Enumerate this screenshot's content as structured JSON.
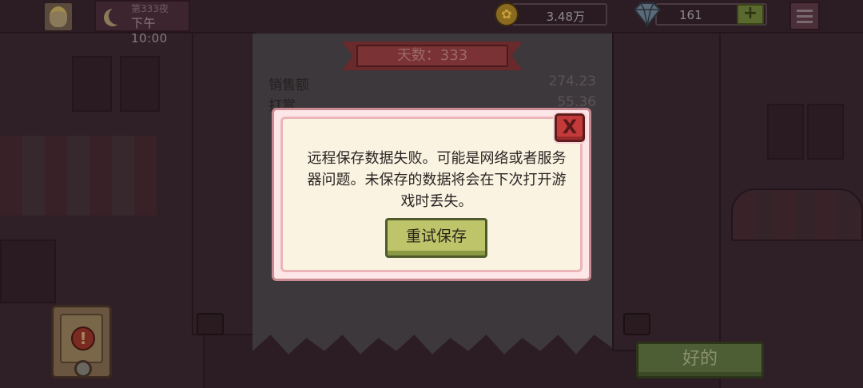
{
  "hud": {
    "day_label": "第333夜",
    "time_label": "下午10:00",
    "coins": "3.48万",
    "gems": "161",
    "plus": "+"
  },
  "receipt": {
    "title": "天数：333",
    "rows": [
      {
        "label": "销售额",
        "value": "274.23"
      },
      {
        "label": "打赏",
        "value": "55.36"
      }
    ]
  },
  "dialog": {
    "message": "远程保存数据失败。可能是网络或者服务器问题。未保存的数据将会在下次打开游戏时丢失。",
    "retry_label": "重试保存",
    "close_label": "X"
  },
  "ok_label": "好的",
  "alert_label": "!"
}
